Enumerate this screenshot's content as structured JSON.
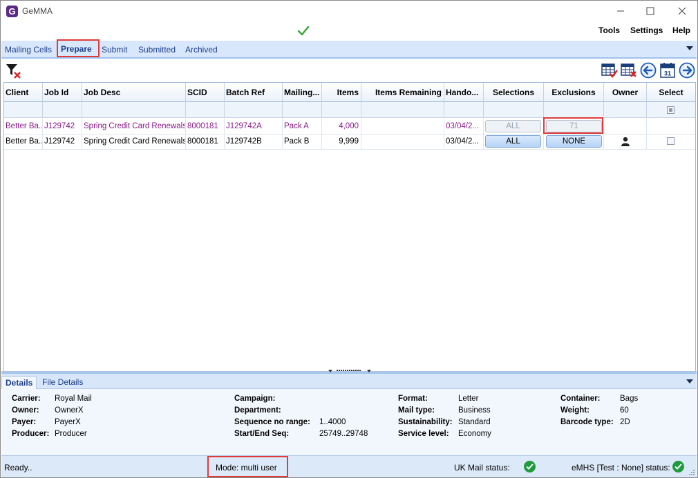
{
  "window": {
    "title": "GeMMA",
    "logo_letter": "G"
  },
  "menu": {
    "items": [
      "Tools",
      "Settings",
      "Help"
    ]
  },
  "tabs": [
    "Mailing Cells",
    "Prepare",
    "Submit",
    "Submitted",
    "Archived"
  ],
  "active_tab": "Prepare",
  "toolbar": {
    "left_icons": [
      "clear-filter-icon"
    ],
    "right_icons": [
      "grid-check-icon",
      "grid-delete-icon",
      "back-arrow-icon",
      "calendar-icon",
      "forward-arrow-icon"
    ],
    "calendar_day": "31"
  },
  "grid": {
    "columns": [
      "Client",
      "Job Id",
      "Job Desc",
      "SCID",
      "Batch Ref",
      "Mailing...",
      "Items",
      "Items Remaining",
      "Hando...",
      "Selections",
      "Exclusions",
      "Owner",
      "Select"
    ],
    "rows": [
      {
        "client": "Better Ba...",
        "job_id": "J129742",
        "job_desc": "Spring Credit Card Renewals",
        "scid": "8000181",
        "batch_ref": "J129742A",
        "mailing": "Pack A",
        "items": "4,000",
        "items_remaining": "",
        "handover": "03/04/2...",
        "selections": "ALL",
        "exclusions": "71",
        "owner": "",
        "style": "purple"
      },
      {
        "client": "Better Ba...",
        "job_id": "J129742",
        "job_desc": "Spring Credit Card Renewals",
        "scid": "8000181",
        "batch_ref": "J129742B",
        "mailing": "Pack B",
        "items": "9,999",
        "items_remaining": "",
        "handover": "03/04/2...",
        "selections": "ALL",
        "exclusions": "NONE",
        "owner": "person-icon",
        "style": "normal"
      }
    ]
  },
  "details": {
    "tabs": [
      "Details",
      "File Details"
    ],
    "col1": [
      {
        "label": "Carrier:",
        "value": "Royal Mail"
      },
      {
        "label": "Owner:",
        "value": "OwnerX"
      },
      {
        "label": "Payer:",
        "value": "PayerX"
      },
      {
        "label": "Producer:",
        "value": "Producer"
      }
    ],
    "col2": [
      {
        "label": "Campaign:",
        "value": ""
      },
      {
        "label": "Department:",
        "value": ""
      },
      {
        "label": "Sequence no range:",
        "value": "1..4000"
      },
      {
        "label": "Start/End Seq:",
        "value": "25749..29748"
      }
    ],
    "col3": [
      {
        "label": "Format:",
        "value": "Letter"
      },
      {
        "label": "Mail type:",
        "value": "Business"
      },
      {
        "label": "Sustainability:",
        "value": "Standard"
      },
      {
        "label": "Service level:",
        "value": "Economy"
      }
    ],
    "col4": [
      {
        "label": "Container:",
        "value": "Bags"
      },
      {
        "label": "Weight:",
        "value": "60"
      },
      {
        "label": "Barcode type:",
        "value": "2D"
      }
    ]
  },
  "status": {
    "ready": "Ready..",
    "mode": "Mode: multi user",
    "uk_mail": "UK Mail status:",
    "emhs": "eMHS [Test : None] status:"
  },
  "colors": {
    "accent": "#1c3f8a",
    "tab_bg": "#d8e7fb",
    "highlight": "#e03a3a",
    "ok_green": "#1f9a3c",
    "purple_text": "#8a1a8a"
  }
}
